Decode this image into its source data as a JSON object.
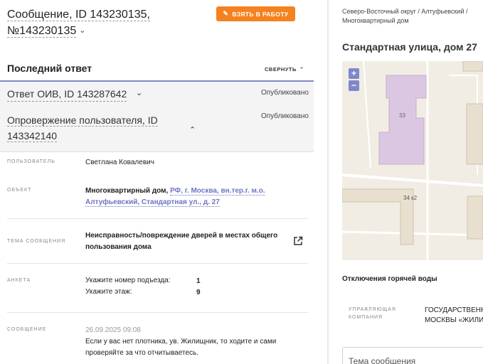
{
  "header": {
    "message_title_line1": "Сообщение, ID 143230135,",
    "message_title_line2": "№143230135",
    "take_button": "ВЗЯТЬ В РАБОТУ"
  },
  "last_answer": {
    "heading": "Последний ответ",
    "collapse_label": "СВЕРНУТЬ",
    "answer_title": "Ответ ОИВ, ID 143287642",
    "answer_status": "Опубликовано",
    "refutation_line1": "Опровержение пользователя, ID",
    "refutation_line2": "143342140",
    "refutation_status": "Опубликовано"
  },
  "details": {
    "user_label": "ПОЛЬЗОВАТЕЛЬ",
    "user_value": "Светлана Ковалевич",
    "object_label": "ОБЪЕКТ",
    "object_prefix": "Многоквартирный дом, ",
    "object_link_line1": "РФ, г. Москва, вн.тер.г. м.о.",
    "object_link_line2": "Алтуфьевский, Стандартная ул., д. 27",
    "topic_label": "ТЕМА СООБЩЕНИЯ",
    "topic_line1": "Неисправность/повреждение дверей в местах общего",
    "topic_line2": "пользования дома",
    "survey_label": "АНКЕТА",
    "survey_q1": "Укажите номер подъезда:",
    "survey_a1": "1",
    "survey_q2": "Укажите этаж:",
    "survey_a2": "9",
    "message_label": "СООБЩЕНИЕ",
    "message_date": "26.09.2025 09:08",
    "message_line1": "Если у вас нет плотника, ув. Жилищник, то ходите и сами",
    "message_line2": "проверяйте за что отчитываетесь."
  },
  "sidebar": {
    "breadcrumb_line1": "Северо-Восточный округ / Алтуфьевский /",
    "breadcrumb_line2": "Многоквартирный дом",
    "address": "Стандартная улица, дом 27",
    "map_label_33": "33",
    "map_label_34k2": "34 к2",
    "zoom_in": "+",
    "zoom_out": "−",
    "hot_water": "Отключения горячей воды",
    "mgmt_label": "УПРАВЛЯЮЩАЯ КОМПАНИЯ",
    "mgmt_line1": "ГОСУДАРСТВЕННОЕ",
    "mgmt_line2": "МОСКВЫ «ЖИЛИЩ",
    "topic_placeholder": "Тема сообщения"
  },
  "colors": {
    "accent_orange": "#f58220",
    "accent_blue": "#7e88c9",
    "building_pink": "#dcc7e2"
  }
}
